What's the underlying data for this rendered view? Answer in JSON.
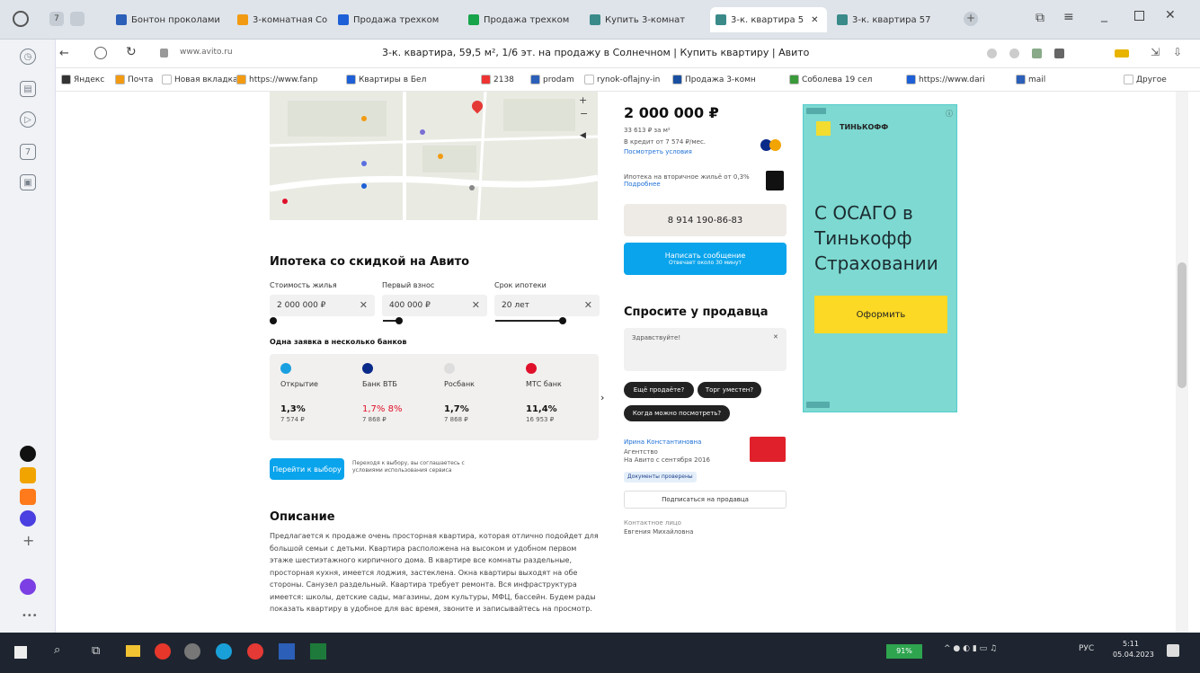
{
  "browser": {
    "tabs": [
      {
        "label": "Бонтон проколами",
        "color": "#2b5fb8"
      },
      {
        "label": "3-комнатная Сол",
        "color": "#f29b12"
      },
      {
        "label": "Продажа трехком",
        "color": "#1d5fd6"
      },
      {
        "label": "Продажа трехком",
        "color": "#17a34a"
      },
      {
        "label": "Купить 3-комнат",
        "color": "#3a8a8a"
      },
      {
        "label": "3-к. квартира 5",
        "color": "#3a8a8a"
      },
      {
        "label": "3-к. квартира 57",
        "color": "#3a8a8a"
      }
    ],
    "address_domain": "www.avito.ru",
    "page_title": "3-к. квартира, 59,5 м², 1/6 эт. на продажу в Солнечном | Купить квартиру | Авито",
    "bookmarks": [
      "Яндекс",
      "Почта",
      "Новая вкладка",
      "https://www.fanp",
      "Квартиры в Бел",
      "2138",
      "prodam",
      "rynok-oflajny-in",
      "Продажа 3-комн",
      "Соболева 19 сел",
      "https://www.dari",
      "mail",
      "Другое"
    ]
  },
  "mortgage": {
    "title": "Ипотека со скидкой на Авито",
    "price_label": "Стоимость жилья",
    "price_value": "2 000 000 ₽",
    "down_label": "Первый взнос",
    "down_value": "400 000 ₽",
    "term_label": "Срок ипотеки",
    "term_value": "20 лет",
    "banks_title": "Одна заявка в несколько банков",
    "banks": [
      {
        "name": "Открытие",
        "rate": "1,3%",
        "payment": "7 574 ₽",
        "color": "#1aa0e0"
      },
      {
        "name": "Банк ВТБ",
        "rate": "1,7% 8%",
        "payment": "7 868 ₽",
        "color": "#0a2a8a"
      },
      {
        "name": "Росбанк",
        "rate": "1,7%",
        "payment": "7 868 ₽",
        "color": "#dddddd"
      },
      {
        "name": "МТС банк",
        "rate": "11,4%",
        "payment": "16 953 ₽",
        "color": "#e0102a"
      }
    ],
    "go_button": "Перейти к выбору",
    "note": "Переходя к выбору, вы соглашаетесь с условиями использования сервиса"
  },
  "description": {
    "title": "Описание",
    "text": "Предлагается к продаже очень просторная квартира, которая отлично подойдет для большой семьи с детьми. Квартира расположена на высоком и удобном первом этаже шестиэтажного кирпичного дома. В квартире все комнаты раздельные, просторная кухня, имеется лоджия, застеклена. Окна квартиры выходят на обе стороны. Санузел раздельный. Квартира требует ремонта. Вся инфраструктура имеется: школы, детские сады, магазины, дом культуры, МФЦ, бассейн. Будем рады показать квартиру в удобное для вас время, звоните и записывайтесь на просмотр."
  },
  "listing": {
    "price": "2 000 000 ₽",
    "per_m2": "33 613 ₽ за м²",
    "credit": "В кредит от 7 574 ₽/мес.",
    "credit_link": "Посмотреть условия",
    "mortgage_small": "Ипотека на вторичное жильё от 0,3%",
    "mortgage_link": "Подробнее",
    "phone": "8 914 190-86-83",
    "write_button": "Написать сообщение",
    "write_sub": "Отвечает около 30 минут",
    "ask_title": "Спросите у продавца",
    "ask_placeholder": "Здравствуйте!",
    "chips": [
      "Ещё продаёте?",
      "Торг уместен?",
      "Когда можно посмотреть?"
    ],
    "seller_name": "Ирина Константиновна",
    "seller_role": "Агентство",
    "seller_since": "На Авито с сентября 2016",
    "seller_badge": "Документы проверены",
    "subscribe": "Подписаться на продавца",
    "contact_label": "Контактное лицо",
    "contact_name": "Евгения Михайловна"
  },
  "ad": {
    "brand": "ТИНЬКОФФ",
    "text": "С ОСАГО в Тинькофф Страховании",
    "cta": "Оформить"
  },
  "taskbar": {
    "battery": "91%",
    "lang": "РУС",
    "time": "5:11",
    "date": "05.04.2023"
  }
}
